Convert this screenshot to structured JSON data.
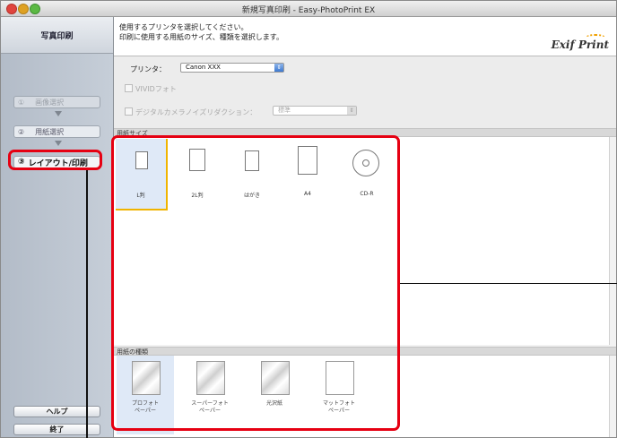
{
  "window": {
    "title": "新規写真印刷 - Easy-PhotoPrint EX"
  },
  "sidebar": {
    "header": "写真印刷",
    "steps": [
      {
        "number": "①",
        "label": "画像選択"
      },
      {
        "number": "②",
        "label": "用紙選択"
      },
      {
        "number": "③",
        "label": "レイアウト/印刷"
      }
    ],
    "help_label": "ヘルプ",
    "exit_label": "終了"
  },
  "instructions": {
    "line1": "使用するプリンタを選択してください。",
    "line2": "印刷に使用する用紙のサイズ、種類を選択します。",
    "logo": "Exif Print"
  },
  "settings": {
    "printer_label": "プリンタ：",
    "printer_value": "Canon XXX",
    "vivid_label": "VIVIDフォト",
    "noise_label": "デジタルカメラノイズリダクション：",
    "noise_value": "標準"
  },
  "paper_size": {
    "header": "用紙サイズ",
    "items": [
      {
        "label": "L判",
        "selected": true
      },
      {
        "label": "2L判",
        "selected": false
      },
      {
        "label": "はがき",
        "selected": false
      },
      {
        "label": "A4",
        "selected": false
      },
      {
        "label": "CD-R",
        "selected": false
      }
    ]
  },
  "media_type": {
    "header": "用紙の種類",
    "items": [
      {
        "line1": "プロフォト",
        "line2": "ペーパー",
        "selected": true
      },
      {
        "line1": "スーパーフォト",
        "line2": "ペーパー",
        "selected": false
      },
      {
        "line1": "光沢紙",
        "line2": "",
        "selected": false
      },
      {
        "line1": "マットフォト",
        "line2": "ペーパー",
        "selected": false
      }
    ]
  },
  "colors": {
    "callout": "#e60012",
    "selection": "#f0b400"
  }
}
